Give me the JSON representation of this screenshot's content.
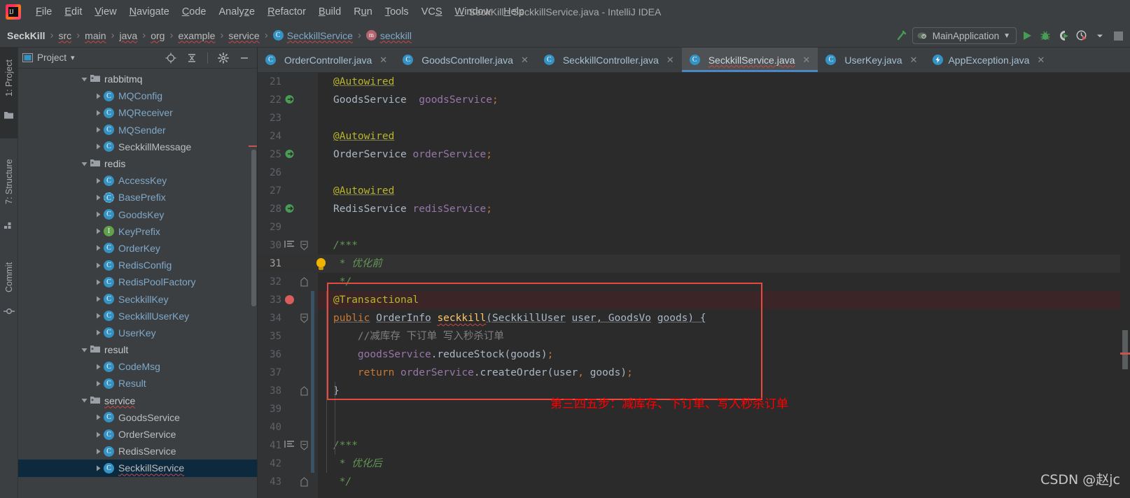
{
  "window": {
    "title": "SeckKill - SeckkillService.java - IntelliJ IDEA",
    "logo_text": "IJ"
  },
  "menubar": {
    "items": [
      {
        "label": "File",
        "mnemonic": "F"
      },
      {
        "label": "Edit",
        "mnemonic": "E"
      },
      {
        "label": "View",
        "mnemonic": "V"
      },
      {
        "label": "Navigate",
        "mnemonic": "N"
      },
      {
        "label": "Code",
        "mnemonic": "C"
      },
      {
        "label": "Analyze",
        "mnemonic": "z"
      },
      {
        "label": "Refactor",
        "mnemonic": "R"
      },
      {
        "label": "Build",
        "mnemonic": "B"
      },
      {
        "label": "Run",
        "mnemonic": "u"
      },
      {
        "label": "Tools",
        "mnemonic": "T"
      },
      {
        "label": "VCS",
        "mnemonic": "S"
      },
      {
        "label": "Window",
        "mnemonic": "W"
      },
      {
        "label": "Help",
        "mnemonic": "H"
      }
    ]
  },
  "navbar": {
    "crumbs": [
      {
        "label": "SeckKill",
        "icon": "",
        "bold": true,
        "squiggle": false
      },
      {
        "label": "src",
        "icon": "",
        "bold": false,
        "squiggle": true
      },
      {
        "label": "main",
        "icon": "",
        "bold": false,
        "squiggle": true
      },
      {
        "label": "java",
        "icon": "",
        "bold": false,
        "squiggle": true
      },
      {
        "label": "org",
        "icon": "",
        "bold": false,
        "squiggle": true
      },
      {
        "label": "example",
        "icon": "",
        "bold": false,
        "squiggle": true
      },
      {
        "label": "service",
        "icon": "",
        "bold": false,
        "squiggle": true
      },
      {
        "label": "SeckkillService",
        "icon": "class-icon",
        "bold": false,
        "squiggle": true
      },
      {
        "label": "seckkill",
        "icon": "method-icon",
        "bold": false,
        "squiggle": true
      }
    ],
    "separator": "›",
    "run_config": "MainApplication",
    "toolbar_icons": [
      "hammer-build-icon",
      "run-icon",
      "debug-icon",
      "run-coverage-icon",
      "profiler-icon",
      "dropdown-icon",
      "stop-icon"
    ]
  },
  "tool_strip": {
    "items": [
      {
        "label": "1: Project",
        "selected": true,
        "icon": "folder-icon"
      },
      {
        "label": "7: Structure",
        "selected": false,
        "icon": "structure-icon"
      },
      {
        "label": "Commit",
        "selected": false,
        "icon": "commit-icon"
      }
    ]
  },
  "project_panel": {
    "title": "Project",
    "dropdown": "▾",
    "header_icons": [
      "locate-icon",
      "collapse-all-icon",
      "settings-gear-icon",
      "hide-icon"
    ],
    "tree": [
      {
        "label": "rabbitmq",
        "type": "package",
        "indent": 4,
        "expanded": true,
        "selected": false
      },
      {
        "label": "MQConfig",
        "type": "class",
        "indent": 5,
        "expanded": false,
        "selected": false
      },
      {
        "label": "MQReceiver",
        "type": "class",
        "indent": 5,
        "expanded": false,
        "selected": false
      },
      {
        "label": "MQSender",
        "type": "class",
        "indent": 5,
        "expanded": false,
        "selected": false
      },
      {
        "label": "SeckkillMessage",
        "type": "class-plain",
        "indent": 5,
        "expanded": false,
        "selected": false
      },
      {
        "label": "redis",
        "type": "package",
        "indent": 4,
        "expanded": true,
        "selected": false
      },
      {
        "label": "AccessKey",
        "type": "class",
        "indent": 5,
        "expanded": false,
        "selected": false
      },
      {
        "label": "BasePrefix",
        "type": "abstract-class",
        "indent": 5,
        "expanded": false,
        "selected": false
      },
      {
        "label": "GoodsKey",
        "type": "class",
        "indent": 5,
        "expanded": false,
        "selected": false
      },
      {
        "label": "KeyPrefix",
        "type": "interface",
        "indent": 5,
        "expanded": false,
        "selected": false
      },
      {
        "label": "OrderKey",
        "type": "class",
        "indent": 5,
        "expanded": false,
        "selected": false
      },
      {
        "label": "RedisConfig",
        "type": "class",
        "indent": 5,
        "expanded": false,
        "selected": false
      },
      {
        "label": "RedisPoolFactory",
        "type": "class",
        "indent": 5,
        "expanded": false,
        "selected": false
      },
      {
        "label": "SeckkillKey",
        "type": "class",
        "indent": 5,
        "expanded": false,
        "selected": false
      },
      {
        "label": "SeckkillUserKey",
        "type": "class",
        "indent": 5,
        "expanded": false,
        "selected": false
      },
      {
        "label": "UserKey",
        "type": "class",
        "indent": 5,
        "expanded": false,
        "selected": false
      },
      {
        "label": "result",
        "type": "package",
        "indent": 4,
        "expanded": true,
        "selected": false
      },
      {
        "label": "CodeMsg",
        "type": "class",
        "indent": 5,
        "expanded": false,
        "selected": false
      },
      {
        "label": "Result",
        "type": "class",
        "indent": 5,
        "expanded": false,
        "selected": false
      },
      {
        "label": "service",
        "type": "package",
        "indent": 4,
        "expanded": true,
        "selected": false,
        "squiggle": true
      },
      {
        "label": "GoodsService",
        "type": "class-plain",
        "indent": 5,
        "expanded": false,
        "selected": false
      },
      {
        "label": "OrderService",
        "type": "class-plain",
        "indent": 5,
        "expanded": false,
        "selected": false
      },
      {
        "label": "RedisService",
        "type": "class-plain",
        "indent": 5,
        "expanded": false,
        "selected": false
      },
      {
        "label": "SeckkillService",
        "type": "class-plain",
        "indent": 5,
        "expanded": false,
        "selected": true,
        "squiggle": true
      }
    ]
  },
  "editor": {
    "tabs": [
      {
        "label": "OrderController.java",
        "icon": "class-icon",
        "active": false
      },
      {
        "label": "GoodsController.java",
        "icon": "class-icon",
        "active": false
      },
      {
        "label": "SeckkillController.java",
        "icon": "class-icon",
        "active": false
      },
      {
        "label": "SeckkillService.java",
        "icon": "class-icon",
        "active": true
      },
      {
        "label": "UserKey.java",
        "icon": "class-icon",
        "active": false
      },
      {
        "label": "AppException.java",
        "icon": "exception-icon",
        "active": false
      }
    ],
    "close_glyph": "✕",
    "lines": [
      {
        "no": "21",
        "gutter": "",
        "text_html": "<span class=\"ann-u\">@Autowired</span>"
      },
      {
        "no": "22",
        "gutter": "run-bean-icon",
        "text_html": "<span class=\"typ\">GoodsService</span>  <span class=\"fld\">goodsService</span><span class=\"kw\">;</span>"
      },
      {
        "no": "23",
        "gutter": "",
        "text_html": ""
      },
      {
        "no": "24",
        "gutter": "",
        "text_html": "<span class=\"ann-u\">@Autowired</span>"
      },
      {
        "no": "25",
        "gutter": "run-bean-icon",
        "text_html": "<span class=\"typ\">OrderService</span> <span class=\"fld\">orderService</span><span class=\"kw\">;</span>"
      },
      {
        "no": "26",
        "gutter": "",
        "text_html": ""
      },
      {
        "no": "27",
        "gutter": "",
        "text_html": "<span class=\"ann-u\">@Autowired</span>"
      },
      {
        "no": "28",
        "gutter": "run-bean-icon",
        "text_html": "<span class=\"typ\">RedisService</span> <span class=\"fld\">redisService</span><span class=\"kw\">;</span>"
      },
      {
        "no": "29",
        "gutter": "",
        "text_html": ""
      },
      {
        "no": "30",
        "gutter": "doc-fold-icon",
        "text_html": "<span class=\"cmt\">/***</span>"
      },
      {
        "no": "31",
        "gutter": "intention-bulb-icon",
        "text_html": " <span class=\"cmt\">* 优化前</span>",
        "current": true
      },
      {
        "no": "32",
        "gutter": "",
        "text_html": " <span class=\"cmt\">*/</span>"
      },
      {
        "no": "33",
        "gutter": "breakpoint-icon",
        "text_html": "<span class=\"ann\">@Transactional</span>",
        "breakpoint": true
      },
      {
        "no": "34",
        "gutter": "",
        "text_html": "<span class=\"kw mu\">public</span> <span class=\"typ mu\">OrderInfo</span> <span class=\"mth mu redsq\">seckkill</span><span class=\"mu\">(</span><span class=\"typ mu\">SeckkillUser</span> <span class=\"ident mu\">user</span><span class=\"mu\">, </span><span class=\"typ mu\">GoodsVo</span> <span class=\"ident mu\">goods</span><span class=\"mu\">) {</span>"
      },
      {
        "no": "35",
        "gutter": "",
        "text_html": "    <span class=\"cmtline\">//减库存 下订单 写入秒杀订单</span>"
      },
      {
        "no": "36",
        "gutter": "",
        "text_html": "    <span class=\"fld\">goodsService</span>.<span class=\"ident\">reduceStock</span>(<span class=\"ident\">goods</span>)<span class=\"kw\">;</span>"
      },
      {
        "no": "37",
        "gutter": "",
        "text_html": "    <span class=\"kw\">return</span> <span class=\"fld\">orderService</span>.<span class=\"ident\">createOrder</span>(<span class=\"ident\">user</span><span class=\"kw\">,</span> <span class=\"ident\">goods</span>)<span class=\"kw\">;</span>"
      },
      {
        "no": "38",
        "gutter": "",
        "text_html": "}"
      },
      {
        "no": "39",
        "gutter": "",
        "text_html": ""
      },
      {
        "no": "40",
        "gutter": "",
        "text_html": ""
      },
      {
        "no": "41",
        "gutter": "doc-fold-icon",
        "text_html": "<span class=\"cmt\">/***</span>"
      },
      {
        "no": "42",
        "gutter": "",
        "text_html": " <span class=\"cmt\">* 优化后</span>"
      },
      {
        "no": "43",
        "gutter": "",
        "text_html": " <span class=\"cmt\">*/</span>"
      }
    ],
    "annotation": {
      "text": "第三四五步：减库存、下订单、写入秒杀订单",
      "color": "#ff0000"
    }
  },
  "watermark": {
    "text": "CSDN @赵jc"
  },
  "colors": {
    "chrome_bg": "#3c3f41",
    "editor_bg": "#2b2b2b",
    "gutter_bg": "#313335",
    "tab_active": "#4e5254",
    "tab_underline": "#4a88c7",
    "selection": "#0d293e",
    "annotation_red": "#ff0000",
    "redbox_border": "#e8483f",
    "accent_class": "#3592c4",
    "accent_interface": "#62a24b",
    "breakpoint": "#db5c5c"
  }
}
